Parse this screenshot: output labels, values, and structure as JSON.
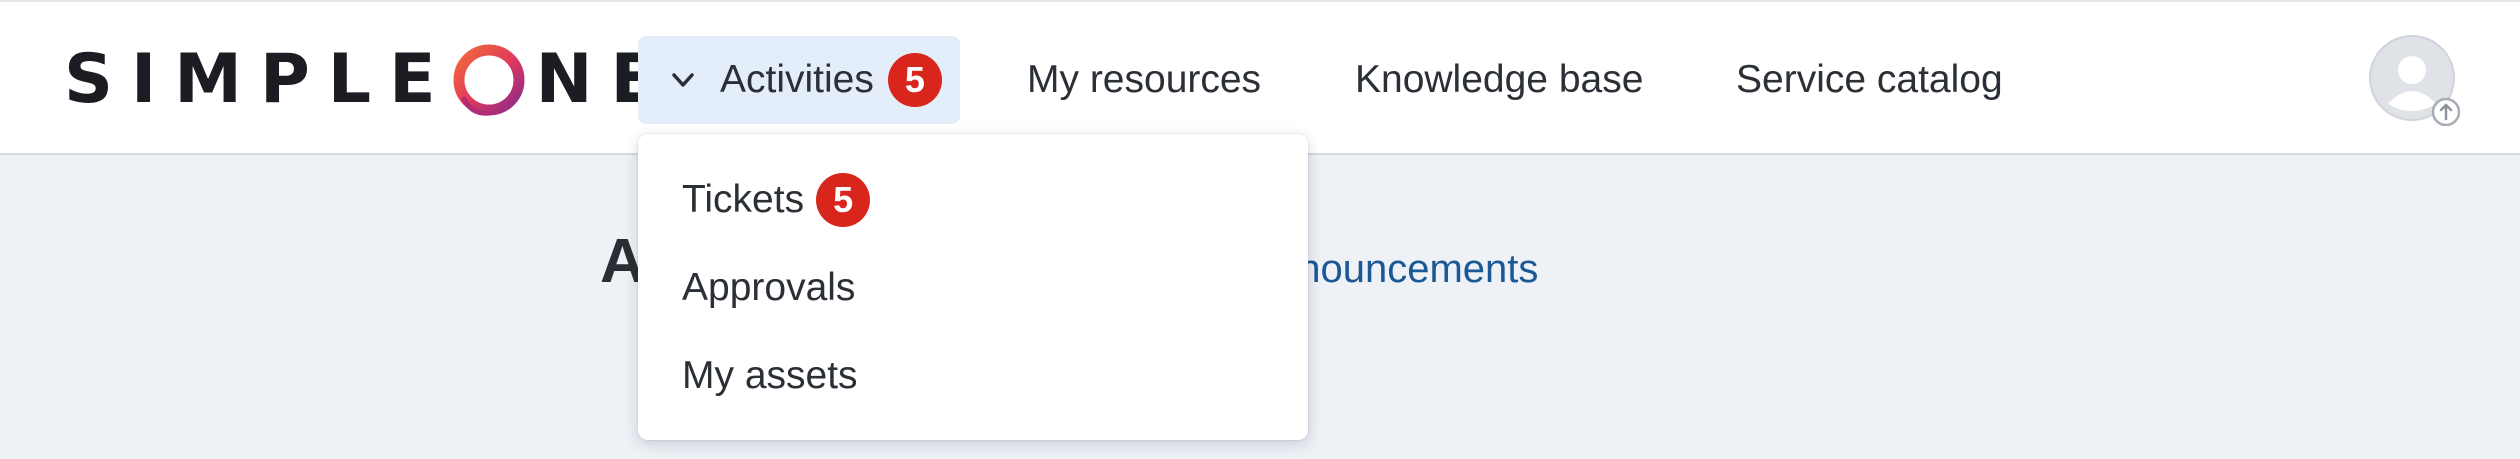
{
  "header": {
    "logo_text_left": "SIMPLE",
    "logo_text_right": "NE",
    "nav": {
      "activities": {
        "label": "Activities",
        "badge": "5"
      },
      "my_resources": "My resources",
      "knowledge_base": "Knowledge base",
      "service_catalog": "Service catalog"
    },
    "avatar_icon": "user-avatar-icon"
  },
  "page": {
    "heading_fragment": "A",
    "link_fragment": "nnouncements"
  },
  "dropdown": {
    "items": [
      {
        "label": "Tickets",
        "badge": "5"
      },
      {
        "label": "Approvals"
      },
      {
        "label": "My assets"
      }
    ]
  },
  "colors": {
    "accent_bg": "#e4eefb",
    "badge": "#d8261c",
    "link": "#1a5896",
    "page_bg": "#eef1f6"
  }
}
